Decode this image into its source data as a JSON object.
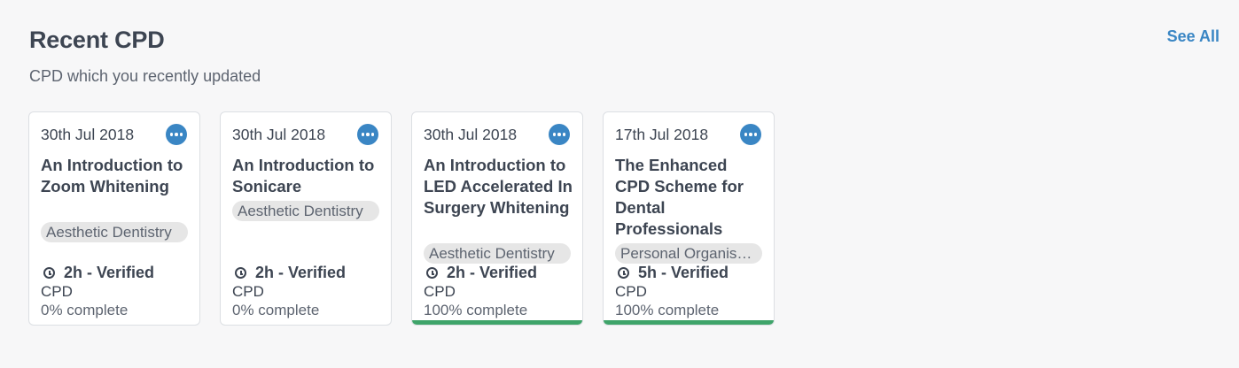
{
  "header": {
    "title": "Recent CPD",
    "subtitle": "CPD which you recently updated",
    "see_all": "See All"
  },
  "colors": {
    "accent": "#3a86c4",
    "progress": "#3fa46a",
    "text": "#3d4552"
  },
  "cards": [
    {
      "date": "30th Jul 2018",
      "title": "An Introduction to Zoom Whitening",
      "category": "Aesthetic Dentistry",
      "duration": "2h - Verified",
      "cpd": "CPD",
      "progress_text": "0% complete",
      "progress": 0
    },
    {
      "date": "30th Jul 2018",
      "title": "An Introduction to Sonicare",
      "category": "Aesthetic Dentistry",
      "duration": "2h - Verified",
      "cpd": "CPD",
      "progress_text": "0% complete",
      "progress": 0
    },
    {
      "date": "30th Jul 2018",
      "title": "An Introduction to LED Accelerated In Surgery Whitening",
      "category": "Aesthetic Dentistry",
      "duration": "2h - Verified",
      "cpd": "CPD",
      "progress_text": "100% complete",
      "progress": 1
    },
    {
      "date": "17th Jul 2018",
      "title": "The Enhanced CPD Scheme for Dental Professionals",
      "category": "Personal Organisation",
      "duration": "5h - Verified",
      "cpd": "CPD",
      "progress_text": "100% complete",
      "progress": 1
    }
  ]
}
